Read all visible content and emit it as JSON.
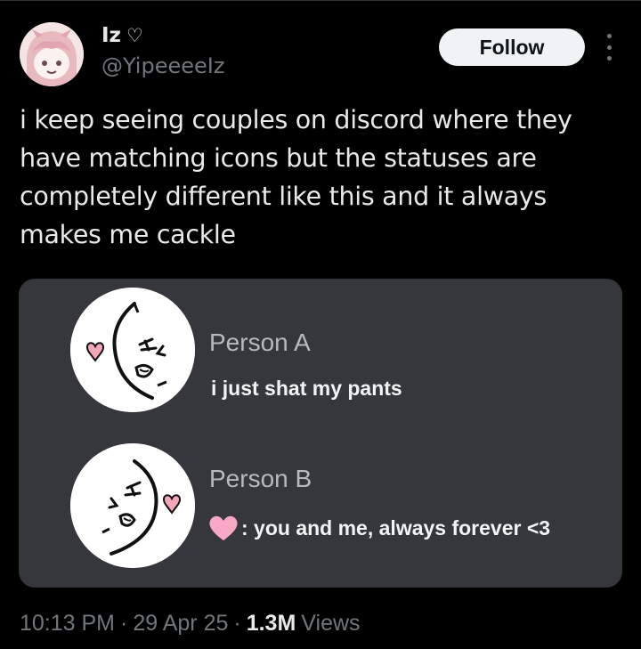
{
  "author": {
    "display_name": "Iz",
    "display_name_icon": "heart-outline-icon",
    "handle": "@YipeeeeIz"
  },
  "actions": {
    "follow_label": "Follow",
    "more_icon": "more-vertical-icon"
  },
  "tweet": {
    "text": "i keep seeing couples on discord where they have matching icons but the statuses are completely different like this and it always makes me cackle"
  },
  "media": {
    "person_a": {
      "name": "Person A",
      "status": "i just shat my pants"
    },
    "person_b": {
      "name": "Person B",
      "status_icon": "pink-heart-icon",
      "status": ": you and me, always forever <3"
    }
  },
  "meta": {
    "time": "10:13 PM",
    "separator": "·",
    "date": "29 Apr 25",
    "views_count": "1.3M",
    "views_label": "Views"
  },
  "colors": {
    "background": "#000000",
    "card_background": "#36373d",
    "pink_heart": "#f7a8c4",
    "muted_text": "#71767b"
  }
}
